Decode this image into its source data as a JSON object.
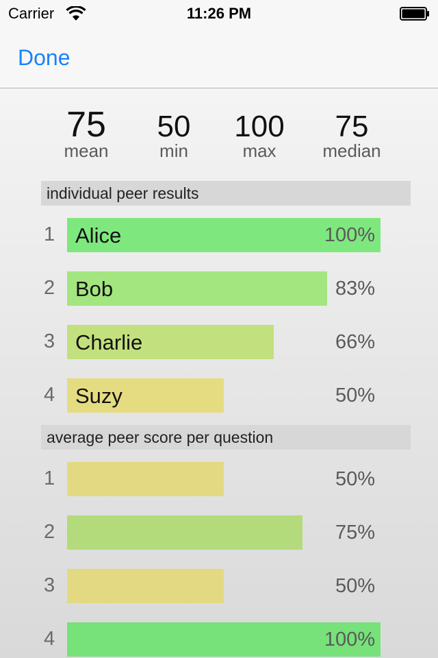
{
  "status": {
    "carrier": "Carrier",
    "time": "11:26 PM"
  },
  "nav": {
    "done_label": "Done"
  },
  "stats": [
    {
      "value": "75",
      "label": "mean"
    },
    {
      "value": "50",
      "label": "min"
    },
    {
      "value": "100",
      "label": "max"
    },
    {
      "value": "75",
      "label": "median"
    }
  ],
  "sections": {
    "individual": "individual peer results",
    "per_question": "average peer score per question"
  },
  "individual_results": [
    {
      "rank": "1",
      "name": "Alice",
      "percent": "100%",
      "fraction": 1.0,
      "color": "#7ee87e"
    },
    {
      "rank": "2",
      "name": "Bob",
      "percent": "83%",
      "fraction": 0.83,
      "color": "#a3e57e"
    },
    {
      "rank": "3",
      "name": "Charlie",
      "percent": "66%",
      "fraction": 0.66,
      "color": "#c3e07e"
    },
    {
      "rank": "4",
      "name": "Suzy",
      "percent": "50%",
      "fraction": 0.5,
      "color": "#e5dc82"
    }
  ],
  "question_scores": [
    {
      "rank": "1",
      "percent": "50%",
      "fraction": 0.5,
      "color": "#e3d982"
    },
    {
      "rank": "2",
      "percent": "75%",
      "fraction": 0.75,
      "color": "#b3db7b"
    },
    {
      "rank": "3",
      "percent": "50%",
      "fraction": 0.5,
      "color": "#e3d982"
    },
    {
      "rank": "4",
      "percent": "100%",
      "fraction": 1.0,
      "color": "#77e17a"
    }
  ],
  "icons": {
    "wifi": "wifi-icon",
    "battery": "battery-icon"
  }
}
